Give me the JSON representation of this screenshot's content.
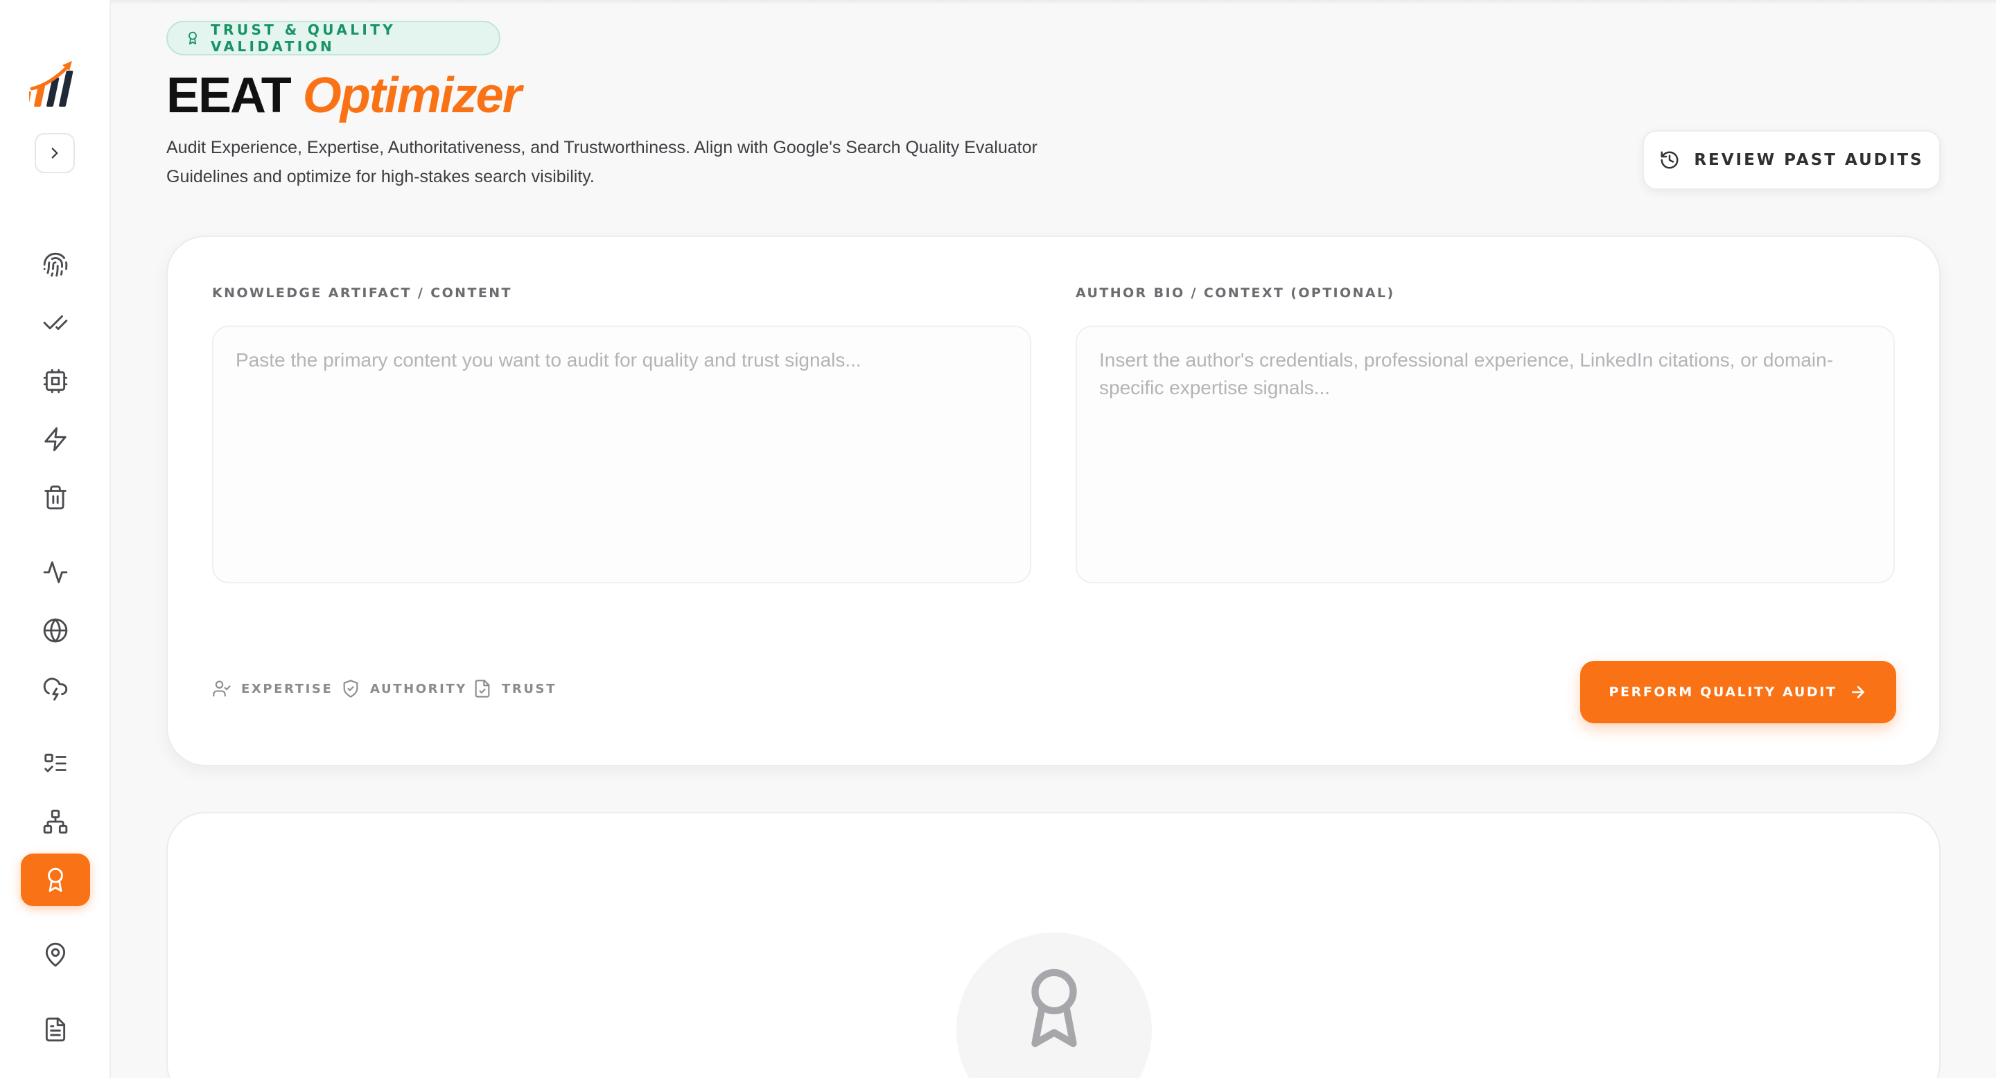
{
  "header": {
    "badge": "TRUST & QUALITY VALIDATION",
    "title_main": "EEAT",
    "title_accent": "Optimizer",
    "subtitle_line1": "Audit Experience, Expertise, Authoritativeness, and Trustworthiness. Align with Google's Search Quality Evaluator",
    "subtitle_line2": "Guidelines and optimize for high-stakes search visibility.",
    "review_button": "REVIEW PAST AUDITS"
  },
  "form": {
    "content_label": "KNOWLEDGE ARTIFACT / CONTENT",
    "content_placeholder": "Paste the primary content you want to audit for quality and trust signals...",
    "content_value": "",
    "bio_label": "AUTHOR BIO / CONTEXT (OPTIONAL)",
    "bio_placeholder": "Insert the author's credentials, professional experience, LinkedIn citations, or domain-specific expertise signals...",
    "bio_value": "",
    "signals": [
      "EXPERTISE",
      "AUTHORITY",
      "TRUST"
    ],
    "submit_button": "PERFORM QUALITY AUDIT"
  },
  "sidebar": {
    "icons": [
      "fingerprint-icon",
      "double-check-icon",
      "cpu-icon",
      "zap-icon",
      "trash-icon",
      "activity-icon",
      "globe-icon",
      "cloud-lightning-icon",
      "list-checks-icon",
      "network-icon",
      "award-icon",
      "map-pin-icon",
      "file-text-icon"
    ],
    "active": "award-icon"
  },
  "colors": {
    "accent": "#f97316",
    "badge_green": "#179365",
    "badge_bg": "#e3f5ee"
  }
}
